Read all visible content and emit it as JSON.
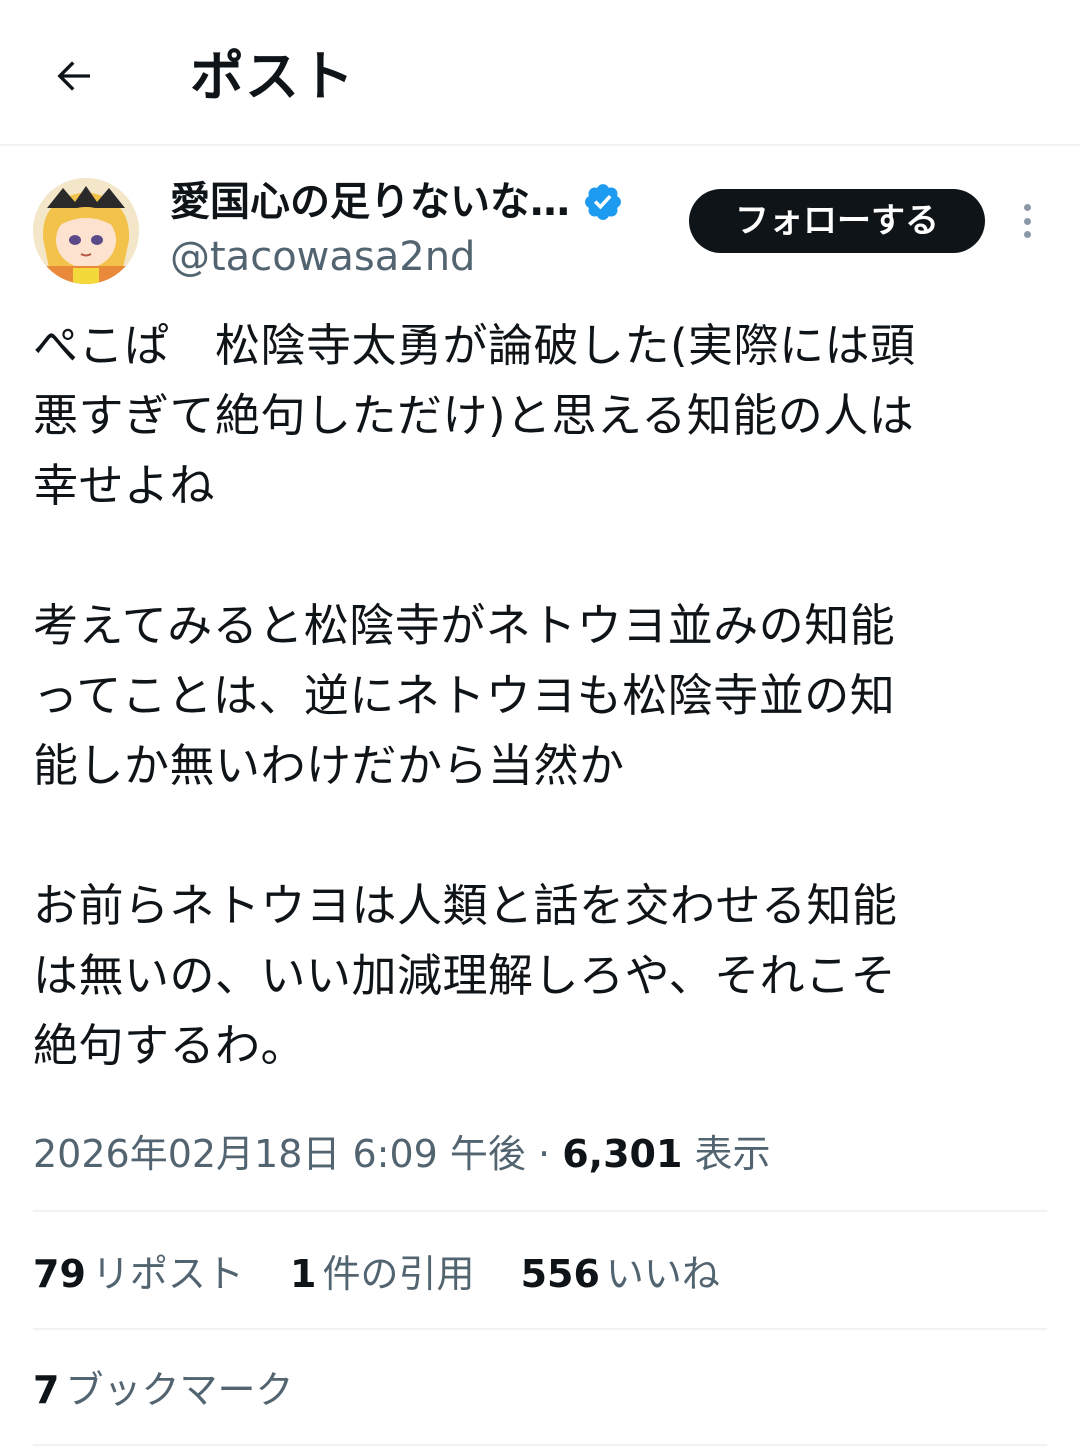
{
  "header": {
    "back_icon": "arrow-left-icon",
    "title": "ポスト"
  },
  "author": {
    "display_name": "愛国心の足りないな…",
    "handle": "@tacowasa2nd",
    "verified_icon": "verified-badge-icon",
    "verified_color": "#1d9bf0",
    "follow_label": "フォローする",
    "more_icon": "more-vertical-icon"
  },
  "post": {
    "text": "ぺこぱ　松陰寺太勇が論破した(実際には頭\n悪すぎて絶句しただけ)と思える知能の人は\n幸せよね\n\n考えてみると松陰寺がネトウヨ並みの知能\nってことは、逆にネトウヨも松陰寺並の知\n能しか無いわけだから当然か\n\nお前らネトウヨは人類と話を交わせる知能\nは無いの、いい加減理解しろや、それこそ\n絶句するわ。"
  },
  "meta": {
    "timestamp": "2026年02月18日 6:09 午後",
    "separator": "·",
    "views_count": "6,301",
    "views_label": "表示"
  },
  "stats": {
    "reposts_count": "79",
    "reposts_label": "リポスト",
    "quotes_count": "1",
    "quotes_label": "件の引用",
    "likes_count": "556",
    "likes_label": "いいね",
    "bookmarks_count": "7",
    "bookmarks_label": "ブックマーク"
  }
}
